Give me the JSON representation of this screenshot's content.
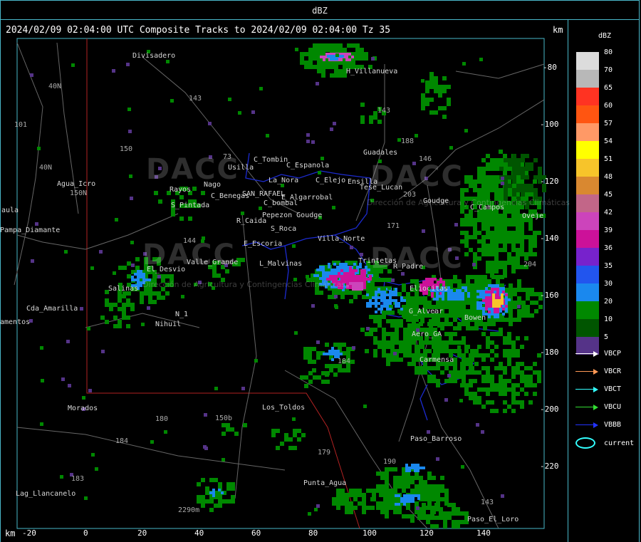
{
  "window_title": "dBZ",
  "header": "2024/02/09 02:04:00 UTC Composite Tracks to 2024/02/09 02:04:00 Tz 35",
  "unit_top": "km",
  "unit_bottom": "km",
  "x_ticks": [
    "-20",
    "0",
    "20",
    "40",
    "60",
    "80",
    "100",
    "120",
    "140"
  ],
  "y_ticks": [
    "-80",
    "-100",
    "-120",
    "-140",
    "-160",
    "-180",
    "-200",
    "-220"
  ],
  "legend": {
    "title": "dBZ",
    "levels": [
      {
        "label": "80",
        "color": "#dcdcdc"
      },
      {
        "label": "70",
        "color": "#b8b8b8"
      },
      {
        "label": "65",
        "color": "#ff3322"
      },
      {
        "label": "60",
        "color": "#ff5511"
      },
      {
        "label": "57",
        "color": "#ff9966"
      },
      {
        "label": "54",
        "color": "#ffff00"
      },
      {
        "label": "51",
        "color": "#f7c42a"
      },
      {
        "label": "48",
        "color": "#d98830"
      },
      {
        "label": "45",
        "color": "#c26688"
      },
      {
        "label": "42",
        "color": "#cc44bb"
      },
      {
        "label": "39",
        "color": "#cc1199"
      },
      {
        "label": "36",
        "color": "#7722cc"
      },
      {
        "label": "35",
        "color": "#2255ee"
      },
      {
        "label": "30",
        "color": "#1a88ee"
      },
      {
        "label": "20",
        "color": "#008800"
      },
      {
        "label": "10",
        "color": "#005500"
      },
      {
        "label": "5",
        "color": "#553388"
      }
    ],
    "tracks": [
      {
        "label": "VBCP",
        "color": "#ffffff"
      },
      {
        "label": "VBCR",
        "color": "#ff9955"
      },
      {
        "label": "VBCT",
        "color": "#33ffff"
      },
      {
        "label": "VBCU",
        "color": "#33dd33"
      },
      {
        "label": "VBBB",
        "color": "#2233ff"
      }
    ],
    "current_label": "current",
    "current_color": "#33ffff"
  },
  "places": [
    {
      "name": "Divisadero"
    },
    {
      "name": "H_Villanueva"
    },
    {
      "name": "Guadales"
    },
    {
      "name": "C_Tombin"
    },
    {
      "name": "Usilla"
    },
    {
      "name": "C_Espanola"
    },
    {
      "name": "La_Nora"
    },
    {
      "name": "C_Elejo"
    },
    {
      "name": "Ensilla"
    },
    {
      "name": "Agua_Icro"
    },
    {
      "name": "Rayos"
    },
    {
      "name": "Nago"
    },
    {
      "name": "C_Benegas"
    },
    {
      "name": "SAN_RAFAEL"
    },
    {
      "name": "E_Algarrobal"
    },
    {
      "name": "Tese_Lucan"
    },
    {
      "name": "Goudge"
    },
    {
      "name": "C_Campos"
    },
    {
      "name": "Oveje"
    },
    {
      "name": "aula"
    },
    {
      "name": "S_Pintada"
    },
    {
      "name": "C_bombal"
    },
    {
      "name": "Pepezon Goudge"
    },
    {
      "name": "Pampa_Diamante"
    },
    {
      "name": "R_Caida"
    },
    {
      "name": "S_Roca"
    },
    {
      "name": "Villa_Norte"
    },
    {
      "name": "E_Escoria"
    },
    {
      "name": "Valle_Grande"
    },
    {
      "name": "L_Malvinas"
    },
    {
      "name": "R_Padre"
    },
    {
      "name": "El_Desvio"
    },
    {
      "name": "Salinas"
    },
    {
      "name": "Cda_Amarilla"
    },
    {
      "name": "amentos"
    },
    {
      "name": "N_1"
    },
    {
      "name": "Nihuil"
    },
    {
      "name": "G_Alvear"
    },
    {
      "name": "Bowen"
    },
    {
      "name": "Aero_GA"
    },
    {
      "name": "Carmensa"
    },
    {
      "name": "Morados"
    },
    {
      "name": "Los_Toldos"
    },
    {
      "name": "Paso_Barroso"
    },
    {
      "name": "Punta_Agua"
    },
    {
      "name": "Lag_Llancanelo"
    },
    {
      "name": "Paso_El_Loro"
    },
    {
      "name": "Trintetas"
    },
    {
      "name": "Eliocitas"
    }
  ],
  "route_numbers": [
    "143",
    "150",
    "101",
    "40N",
    "40N",
    "150N",
    "143",
    "146",
    "188",
    "203",
    "171",
    "144",
    "73",
    "204",
    "184",
    "180",
    "184",
    "183",
    "179",
    "190",
    "143",
    "150b"
  ],
  "watermark": {
    "text": "DACC",
    "subtitle": "Dirección de Agricultura y Contingencias Climáticas"
  },
  "misc_labels": [
    "2290m"
  ]
}
